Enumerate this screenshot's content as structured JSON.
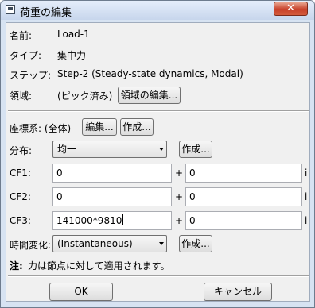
{
  "window": {
    "title": "荷重の編集",
    "close": "✕"
  },
  "name": {
    "label": "名前:",
    "value": "Load-1"
  },
  "type": {
    "label": "タイプ:",
    "value": "集中力"
  },
  "step": {
    "label": "ステップ:",
    "value": "Step-2 (Steady-state dynamics, Modal)"
  },
  "region": {
    "label": "領域:",
    "value": "(ピック済み)",
    "edit_button": "領域の編集..."
  },
  "csys": {
    "label": "座標系: (全体)",
    "edit_button": "編集...",
    "create_button": "作成..."
  },
  "distribution": {
    "label": "分布:",
    "selected": "均一",
    "create_button": "作成..."
  },
  "cf1": {
    "label": "CF1:",
    "real": "0",
    "plus": "+",
    "imag": "0",
    "imag_unit": "i"
  },
  "cf2": {
    "label": "CF2:",
    "real": "0",
    "plus": "+",
    "imag": "0",
    "imag_unit": "i"
  },
  "cf3": {
    "label": "CF3:",
    "real": "141000*9810",
    "plus": "+",
    "imag": "0",
    "imag_unit": "i"
  },
  "amplitude": {
    "label": "時間変化:",
    "selected": "(Instantaneous)",
    "create_button": "作成..."
  },
  "note": {
    "bold": "注:",
    "text": "力は節点に対して適用されます。"
  },
  "footer": {
    "ok": "OK",
    "cancel": "キャンセル"
  }
}
